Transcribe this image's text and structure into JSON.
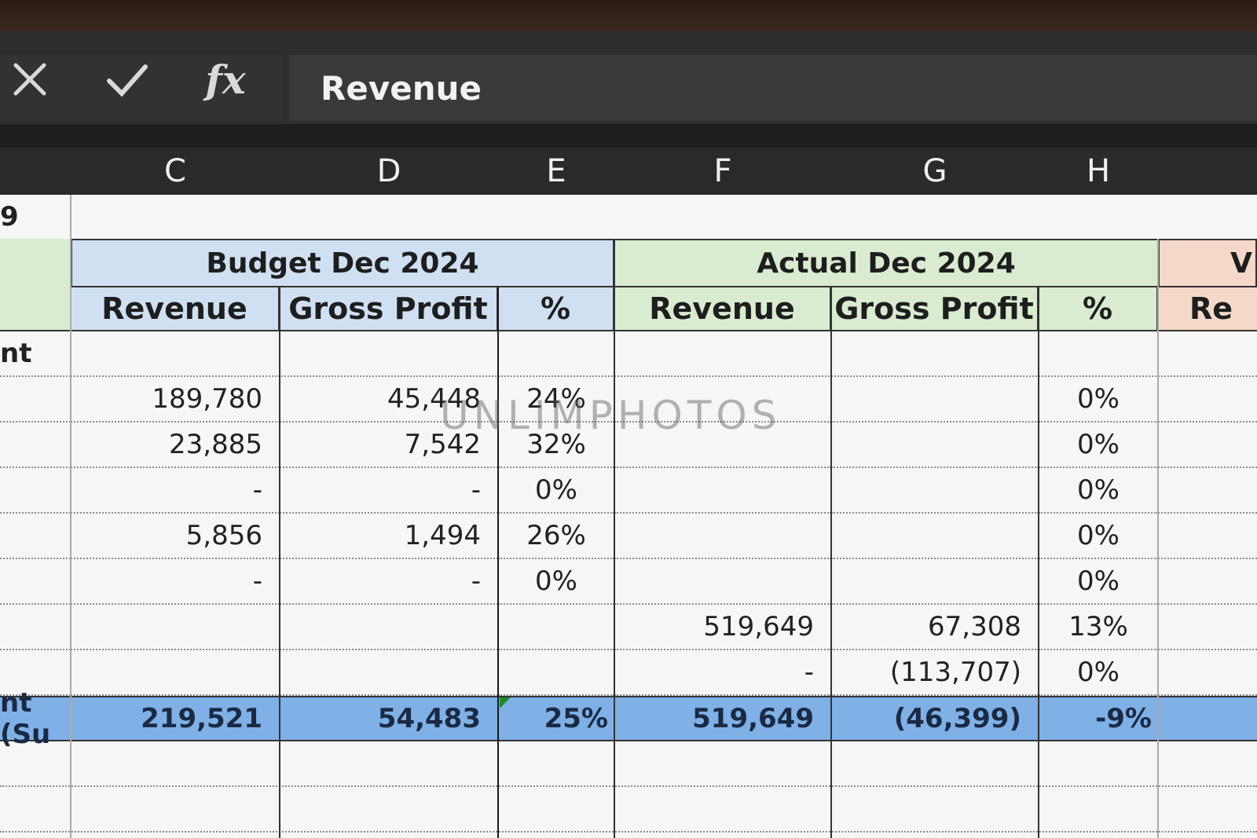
{
  "formula_bar": {
    "cancel_icon": "close-icon",
    "confirm_icon": "check-icon",
    "function_label": "fx",
    "value": "Revenue"
  },
  "columns": [
    "C",
    "D",
    "E",
    "F",
    "G",
    "H"
  ],
  "row_labels": {
    "top": "9",
    "section": "nt",
    "total": "nt (Su"
  },
  "groups": {
    "budget": "Budget Dec 2024",
    "actual": "Actual Dec 2024",
    "variance_partial": "V"
  },
  "subheaders": {
    "budget": [
      "Revenue",
      "Gross Profit",
      "%"
    ],
    "actual": [
      "Revenue",
      "Gross Profit",
      "%"
    ],
    "variance_partial": "Re"
  },
  "rows": [
    {
      "c": "189,780",
      "d": "45,448",
      "e": "24%",
      "f": "",
      "g": "",
      "h": "0%"
    },
    {
      "c": "23,885",
      "d": "7,542",
      "e": "32%",
      "f": "",
      "g": "",
      "h": "0%"
    },
    {
      "c": "-",
      "d": "-",
      "e": "0%",
      "f": "",
      "g": "",
      "h": "0%"
    },
    {
      "c": "5,856",
      "d": "1,494",
      "e": "26%",
      "f": "",
      "g": "",
      "h": "0%"
    },
    {
      "c": "-",
      "d": "-",
      "e": "0%",
      "f": "",
      "g": "",
      "h": "0%"
    },
    {
      "c": "",
      "d": "",
      "e": "",
      "f": "519,649",
      "g": "67,308",
      "h": "13%"
    },
    {
      "c": "",
      "d": "",
      "e": "",
      "f": "-",
      "g": "(113,707)",
      "h": "0%"
    }
  ],
  "total_row": {
    "c": "219,521",
    "d": "54,483",
    "e": "25%",
    "f": "519,649",
    "g": "(46,399)",
    "h": "-9%"
  },
  "watermark": "UNLIMPHOTOS",
  "colors": {
    "budget_header": "#cfe0f3",
    "actual_header": "#d9ecd0",
    "variance_header": "#f4d9c8",
    "total_fill": "#7fb0e6"
  }
}
